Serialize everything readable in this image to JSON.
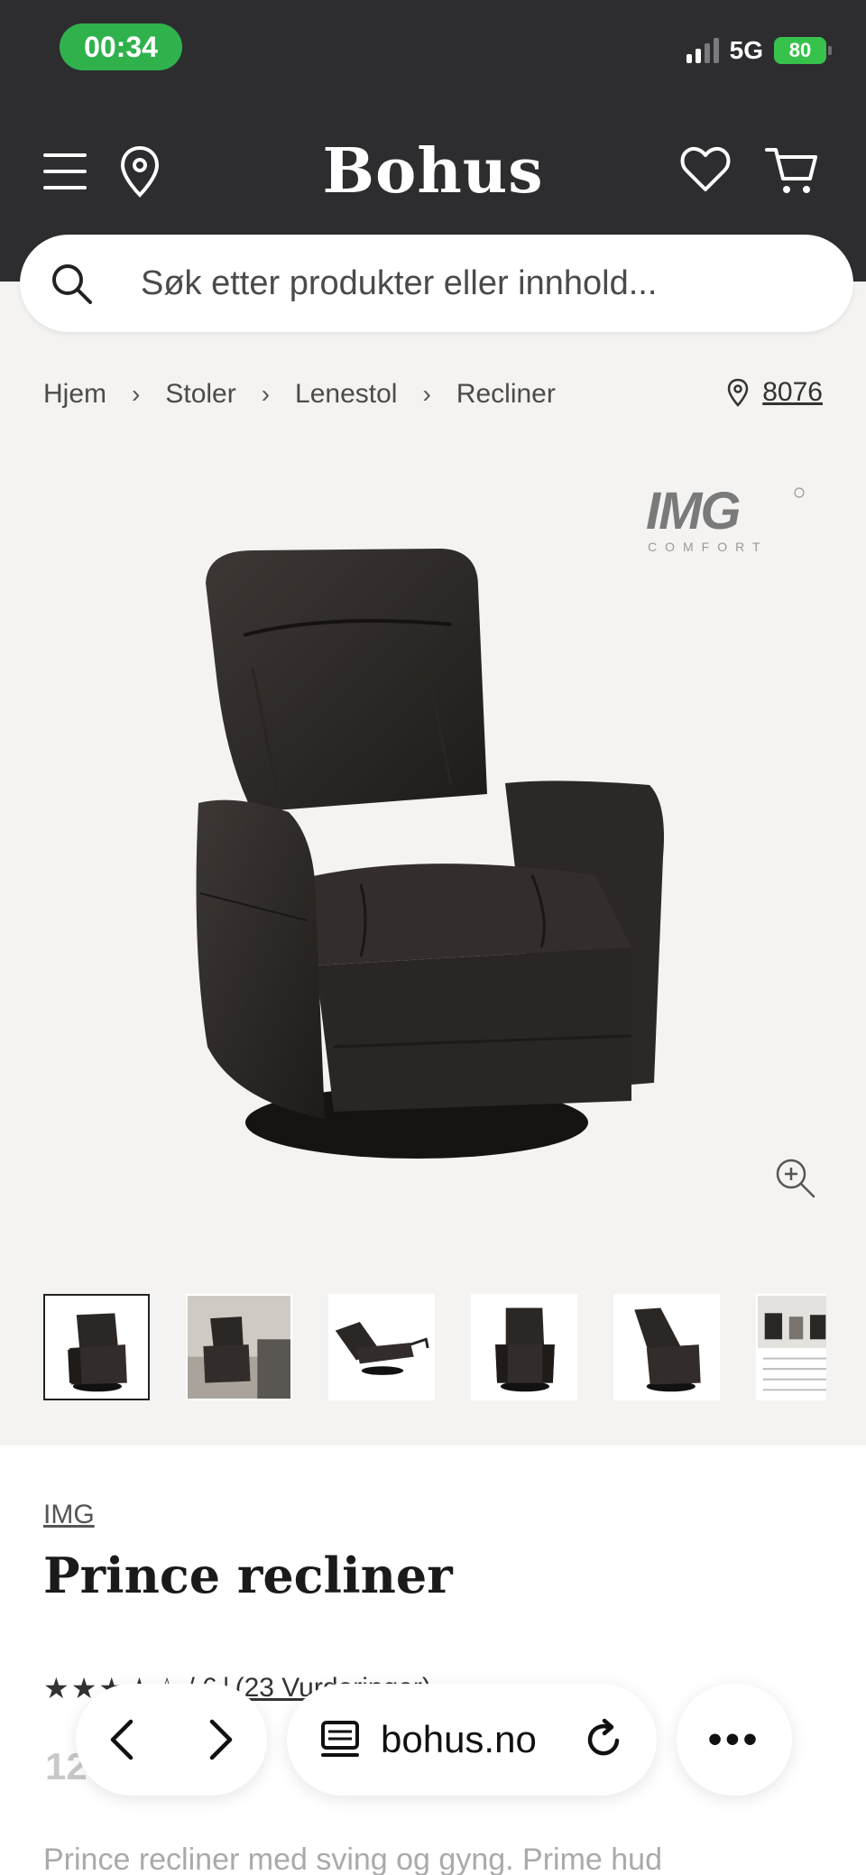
{
  "status_bar": {
    "time": "00:34",
    "network": "5G",
    "battery": "80"
  },
  "header": {
    "logo": "Bohus"
  },
  "search": {
    "placeholder": "Søk etter produkter eller innhold..."
  },
  "breadcrumb": [
    "Hjem",
    "Stoler",
    "Lenestol",
    "Recliner"
  ],
  "store": {
    "number": "8076"
  },
  "gallery": {
    "brand_logo_text": "IMG",
    "brand_logo_sub": "COMFORT",
    "thumbnail_count": 6,
    "selected_index": 0
  },
  "product": {
    "brand": "IMG",
    "title": "Prince recliner",
    "rating_text": "/ 6",
    "reviews_text": "(23 Vurderinger)",
    "price_partial": "12",
    "description_partial": "Prince recliner med sving og gyng. Prime hud"
  },
  "browser": {
    "url": "bohus.no",
    "more_label": "•••"
  },
  "colors": {
    "header_bg": "#2d2d30",
    "time_pill": "#2fb24c",
    "battery": "#37c24b",
    "page_bg": "#f4f3f1"
  }
}
